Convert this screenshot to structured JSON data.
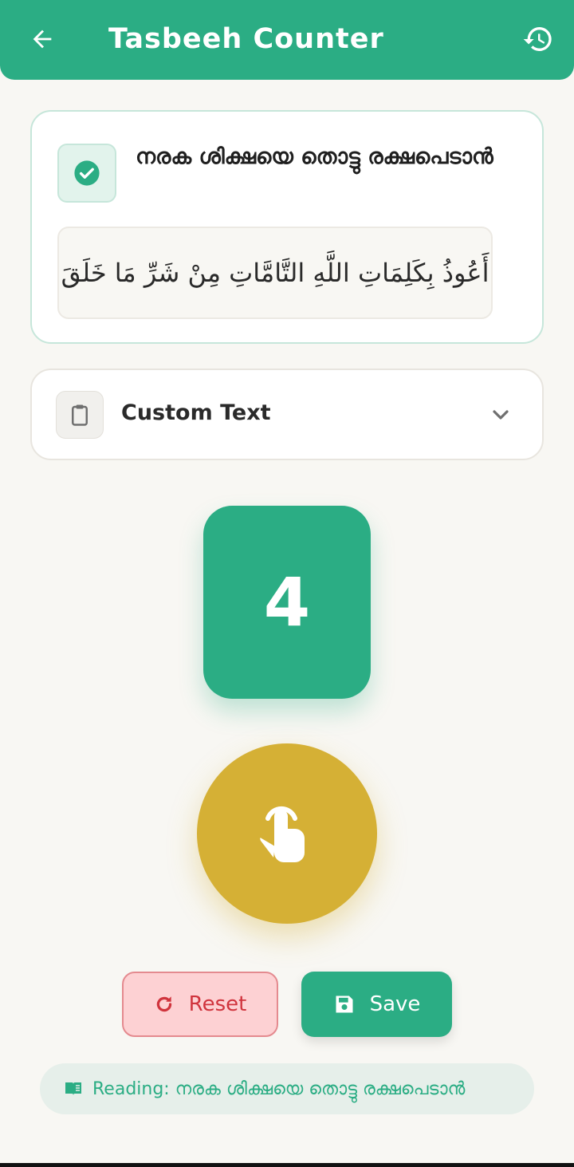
{
  "app": {
    "title": "Tasbeeh Counter"
  },
  "dhikr": {
    "title": "നരക ശിക്ഷയെ തൊട്ടു രക്ഷപെടാൻ",
    "arabic": "أَعُوذُ بِكَلِمَاتِ اللَّهِ التَّامَّاتِ مِنْ شَرِّ مَا خَلَقَ",
    "selected": true
  },
  "custom": {
    "label": "Custom Text"
  },
  "counter": {
    "value": "4"
  },
  "actions": {
    "reset_label": "Reset",
    "save_label": "Save"
  },
  "status": {
    "reading_text": "Reading: നരക ശിക്ഷയെ തൊട്ടു രക്ഷപെടാൻ"
  },
  "colors": {
    "primary": "#2bad84",
    "tap_button": "#d5b035",
    "reset_bg": "#fdd1d3",
    "reset_text": "#d0343d",
    "background": "#f8f7f3"
  },
  "icons": {
    "back": "arrow-left-icon",
    "history": "history-icon",
    "check": "check-circle-icon",
    "clipboard": "clipboard-icon",
    "chevron": "chevron-down-icon",
    "tap": "tap-hand-icon",
    "reset": "refresh-icon",
    "save": "save-icon",
    "reading": "book-icon"
  }
}
